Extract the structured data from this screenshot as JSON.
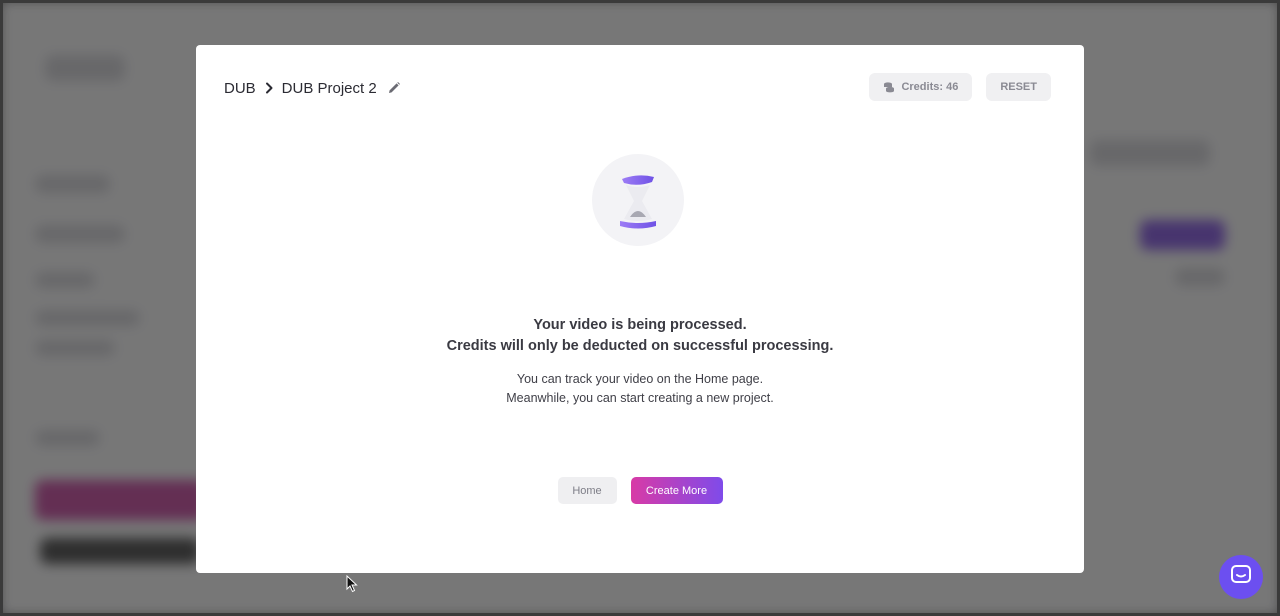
{
  "breadcrumb": {
    "root": "DUB",
    "project": "DUB Project 2"
  },
  "top_actions": {
    "credits_label": "Credits: 46",
    "reset_label": "RESET"
  },
  "status": {
    "line1": "Your video is being processed.",
    "line2": "Credits will only be deducted on successful processing.",
    "info1": "You can track your video on the Home page.",
    "info2": "Meanwhile, you can start creating a new project."
  },
  "actions": {
    "home_label": "Home",
    "create_label": "Create More"
  },
  "icons": {
    "separator": "chevron-right-icon",
    "edit": "pencil-icon",
    "credits": "coins-icon",
    "status": "hourglass-icon",
    "chat": "chat-icon"
  },
  "colors": {
    "accent_start": "#d83aa6",
    "accent_end": "#7f4bea",
    "chat": "#6c4ff0"
  }
}
